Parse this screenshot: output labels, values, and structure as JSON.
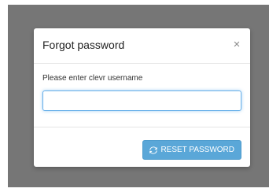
{
  "dialog": {
    "title": "Forgot password",
    "close_glyph": "×",
    "close_icon": "close-icon"
  },
  "form": {
    "label": "Please enter clevr username",
    "username_value": "",
    "username_placeholder": ""
  },
  "actions": {
    "reset_label": "RESET PASSWORD",
    "reset_icon": "refresh-icon"
  },
  "colors": {
    "overlay": "#767676",
    "primary_button": "#5aa7d8",
    "focus_border": "#66afe9"
  }
}
